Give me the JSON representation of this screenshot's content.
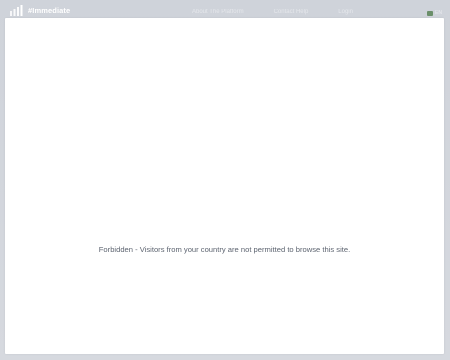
{
  "brand": {
    "logo_text": "#Immediate",
    "logo_icon": "bar-chart-icon"
  },
  "nav": {
    "items": [
      {
        "label": "About The Platform"
      },
      {
        "label": "Contact Help"
      },
      {
        "label": "Login"
      }
    ]
  },
  "language": {
    "code": "EN",
    "flag_icon": "flag-icon"
  },
  "modal": {
    "message": "Forbidden - Visitors from your country are not permitted to browse this site."
  },
  "colors": {
    "background": "#d3d6dd",
    "modal": "#ffffff",
    "message_text": "#5d6470"
  }
}
